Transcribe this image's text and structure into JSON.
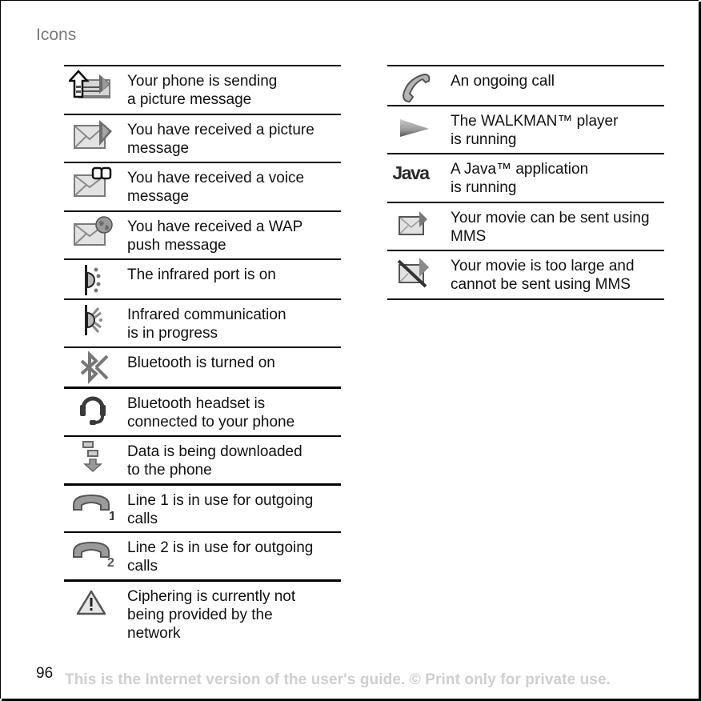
{
  "page": {
    "heading": "Icons",
    "page_number": "96",
    "footer": "This is the Internet version of the user's guide. © Print only for private use."
  },
  "left_table": [
    {
      "icon": "picture-message-sending-icon",
      "text": "Your phone is sending\na picture message"
    },
    {
      "icon": "picture-message-received-icon",
      "text": "You have received a picture\nmessage"
    },
    {
      "icon": "voice-message-received-icon",
      "text": "You have received a voice\nmessage"
    },
    {
      "icon": "wap-push-message-icon",
      "text": "You have received a WAP\npush message"
    },
    {
      "icon": "infrared-port-on-icon",
      "text": "The infrared port is on"
    },
    {
      "icon": "infrared-communication-icon",
      "text": "Infrared communication\nis in progress"
    },
    {
      "icon": "bluetooth-icon",
      "text": "Bluetooth is turned on"
    },
    {
      "icon": "bluetooth-headset-icon",
      "text": "Bluetooth headset is\nconnected to your phone"
    },
    {
      "icon": "data-download-icon",
      "text": "Data is being downloaded\nto the phone"
    },
    {
      "icon": "line-1-outgoing-icon",
      "text": "Line 1 is in use for outgoing\ncalls"
    },
    {
      "icon": "line-2-outgoing-icon",
      "text": "Line 2 is in use for outgoing\ncalls"
    },
    {
      "icon": "ciphering-warning-icon",
      "text": "Ciphering is currently not\nbeing provided by the\nnetwork"
    }
  ],
  "right_table": [
    {
      "icon": "ongoing-call-icon",
      "text": "An ongoing call"
    },
    {
      "icon": "walkman-player-icon",
      "text": "The WALKMAN™ player\nis running"
    },
    {
      "icon": "java-application-icon",
      "text": "A Java™ application\nis running",
      "icon_label": "Java"
    },
    {
      "icon": "movie-mms-ok-icon",
      "text": "Your movie can be sent using\nMMS"
    },
    {
      "icon": "movie-mms-too-large-icon",
      "text": "Your movie is too large and\ncannot be sent using MMS"
    }
  ],
  "icon_labels": {
    "line_1": "1",
    "line_2": "2"
  },
  "colors": {
    "heading": "#7a7a7a",
    "text": "#111111",
    "footer": "#cfcfcf",
    "icon_gray": "#8a8a8a",
    "icon_dark": "#3a3a3a"
  }
}
